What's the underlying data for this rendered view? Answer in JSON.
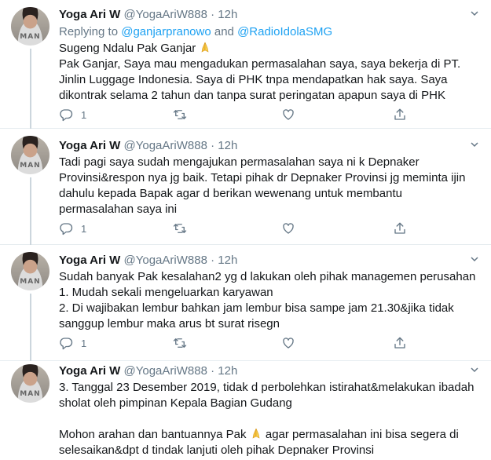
{
  "tweets": [
    {
      "name": "Yoga Ari W",
      "handle": "@YogaAriW888",
      "dot": "·",
      "time": "12h",
      "reply_prefix": "Replying to ",
      "reply_mention_1": "@ganjarpranowo",
      "reply_and": " and ",
      "reply_mention_2": "@RadioIdolaSMG",
      "text_1": "Sugeng Ndalu Pak Ganjar ",
      "text_2": "\nPak Ganjar, Saya mau mengadukan permasalahan saya, saya bekerja di PT. Jinlin Luggage Indonesia. Saya di PHK tnpa mendapatkan hak saya. Saya dikontrak selama 2 tahun dan tanpa surat peringatan apapun saya di PHK",
      "reply_count": "1"
    },
    {
      "name": "Yoga Ari W",
      "handle": "@YogaAriW888",
      "dot": "·",
      "time": "12h",
      "text": "Tadi pagi saya sudah mengajukan permasalahan saya ni k Depnaker Provinsi&respon nya jg baik. Tetapi pihak dr Depnaker Provinsi jg meminta ijin dahulu kepada Bapak agar d berikan wewenang untuk membantu permasalahan saya ini",
      "reply_count": "1"
    },
    {
      "name": "Yoga Ari W",
      "handle": "@YogaAriW888",
      "dot": "·",
      "time": "12h",
      "text": "Sudah banyak Pak kesalahan2 yg d lakukan oleh pihak managemen perusahan\n1. Mudah sekali mengeluarkan karyawan\n2. Di wajibakan lembur bahkan jam lembur bisa sampe jam 21.30&jika tidak sanggup lembur maka arus bt surat risegn",
      "reply_count": "1"
    },
    {
      "name": "Yoga Ari W",
      "handle": "@YogaAriW888",
      "dot": "·",
      "time": "12h",
      "text_1": "3. Tanggal 23 Desember 2019, tidak d perbolehkan istirahat&melakukan ibadah sholat oleh pimpinan Kepala Bagian Gudang\n\nMohon arahan dan bantuannya Pak ",
      "text_2": " agar permasalahan ini bisa segera di selesaikan&dpt d tindak lanjuti oleh pihak Depnaker Provinsi"
    }
  ],
  "icons": {
    "reply": "reply-icon",
    "retweet": "retweet-icon",
    "like": "like-icon",
    "share": "share-icon",
    "caret": "chevron-down-icon",
    "emoji": "folded-hands-emoji"
  },
  "colors": {
    "link": "#1da1f2",
    "muted": "#657786",
    "text": "#14171a",
    "divider": "#e6ecf0",
    "thread_line": "#ccd6dd"
  }
}
